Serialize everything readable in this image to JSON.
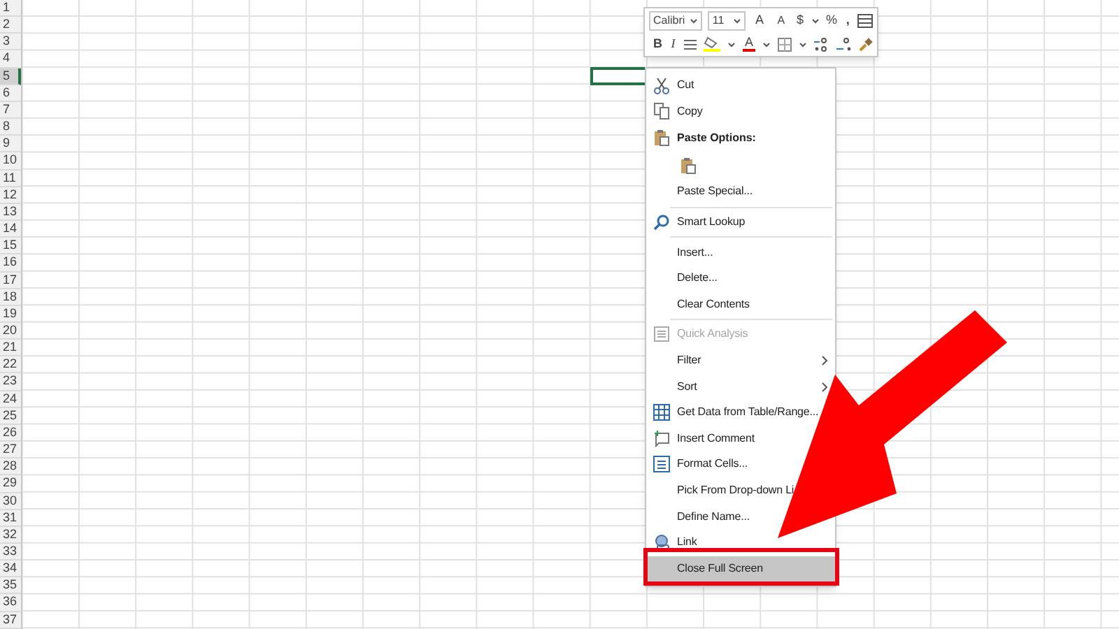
{
  "rows": [
    {
      "label": "1",
      "selected": false
    },
    {
      "label": "2",
      "selected": false
    },
    {
      "label": "3",
      "selected": false
    },
    {
      "label": "4",
      "selected": false
    },
    {
      "label": "5",
      "selected": true
    },
    {
      "label": "6",
      "selected": false
    },
    {
      "label": "7",
      "selected": false
    },
    {
      "label": "8",
      "selected": false
    },
    {
      "label": "9",
      "selected": false
    },
    {
      "label": "10",
      "selected": false
    },
    {
      "label": "11",
      "selected": false
    },
    {
      "label": "12",
      "selected": false
    },
    {
      "label": "13",
      "selected": false
    },
    {
      "label": "14",
      "selected": false
    },
    {
      "label": "15",
      "selected": false
    },
    {
      "label": "16",
      "selected": false
    },
    {
      "label": "17",
      "selected": false
    },
    {
      "label": "18",
      "selected": false
    },
    {
      "label": "19",
      "selected": false
    },
    {
      "label": "20",
      "selected": false
    },
    {
      "label": "21",
      "selected": false
    },
    {
      "label": "22",
      "selected": false
    },
    {
      "label": "23",
      "selected": false
    },
    {
      "label": "24",
      "selected": false
    },
    {
      "label": "25",
      "selected": false
    },
    {
      "label": "26",
      "selected": false
    },
    {
      "label": "27",
      "selected": false
    },
    {
      "label": "28",
      "selected": false
    },
    {
      "label": "29",
      "selected": false
    },
    {
      "label": "30",
      "selected": false
    },
    {
      "label": "31",
      "selected": false
    },
    {
      "label": "32",
      "selected": false
    },
    {
      "label": "33",
      "selected": false
    },
    {
      "label": "34",
      "selected": false
    },
    {
      "label": "35",
      "selected": false
    },
    {
      "label": "36",
      "selected": false
    },
    {
      "label": "37",
      "selected": false
    }
  ],
  "mini_toolbar": {
    "font_name": "Calibri",
    "font_size": "11",
    "grow_font": "A",
    "shrink_font": "A",
    "currency": "$",
    "percent": "%",
    "comma": ",",
    "bold": "B",
    "italic": "I",
    "font_color": "A"
  },
  "context_menu": [
    {
      "kind": "item",
      "label": "Cut",
      "disabled": false,
      "selected": false
    },
    {
      "kind": "item",
      "label": "Copy",
      "disabled": false,
      "selected": false
    },
    {
      "kind": "header",
      "label": "Paste Options:"
    },
    {
      "kind": "paste-option"
    },
    {
      "kind": "item",
      "label": "Paste Special...",
      "disabled": false,
      "selected": false
    },
    {
      "kind": "separator"
    },
    {
      "kind": "item",
      "label": "Smart Lookup",
      "disabled": false,
      "selected": false
    },
    {
      "kind": "separator"
    },
    {
      "kind": "item",
      "label": "Insert...",
      "disabled": false,
      "selected": false
    },
    {
      "kind": "item",
      "label": "Delete...",
      "disabled": false,
      "selected": false
    },
    {
      "kind": "item",
      "label": "Clear Contents",
      "disabled": false,
      "selected": false
    },
    {
      "kind": "separator"
    },
    {
      "kind": "item",
      "label": "Quick Analysis",
      "disabled": true,
      "selected": false
    },
    {
      "kind": "item",
      "label": "Filter",
      "disabled": false,
      "submenu": true,
      "selected": false
    },
    {
      "kind": "item",
      "label": "Sort",
      "disabled": false,
      "submenu": true,
      "selected": false
    },
    {
      "kind": "item",
      "label": "Get Data from Table/Range...",
      "disabled": false,
      "selected": false
    },
    {
      "kind": "item",
      "label": "Insert Comment",
      "disabled": false,
      "selected": false
    },
    {
      "kind": "item",
      "label": "Format Cells...",
      "disabled": false,
      "selected": false
    },
    {
      "kind": "item",
      "label": "Pick From Drop-down Li",
      "disabled": false,
      "selected": false
    },
    {
      "kind": "item",
      "label": "Define Name...",
      "disabled": false,
      "selected": false
    },
    {
      "kind": "item",
      "label": "Link",
      "disabled": false,
      "selected": false
    },
    {
      "kind": "item",
      "label": "Close Full Screen",
      "disabled": false,
      "selected": true
    }
  ]
}
